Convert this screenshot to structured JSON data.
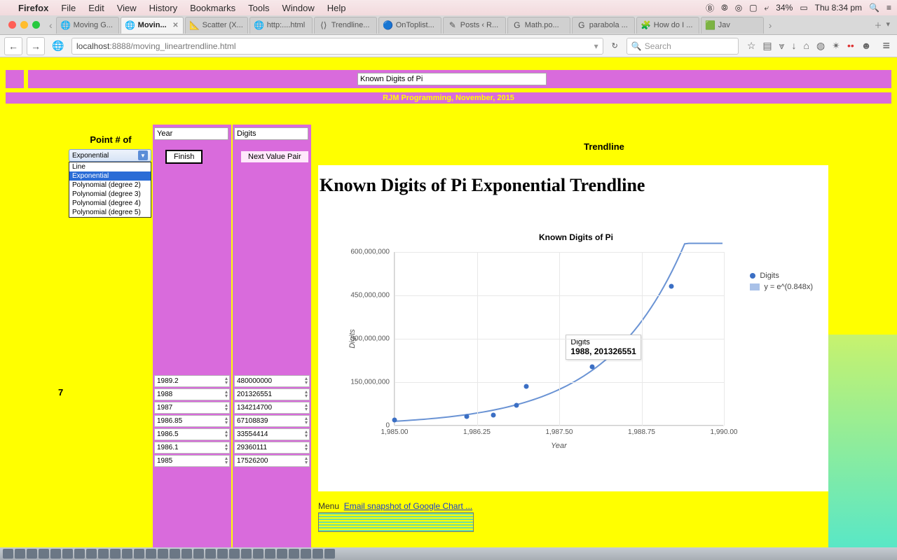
{
  "menubar": {
    "app": "Firefox",
    "items": [
      "File",
      "Edit",
      "View",
      "History",
      "Bookmarks",
      "Tools",
      "Window",
      "Help"
    ],
    "battery": "34%",
    "clock": "Thu 8:34 pm"
  },
  "tabs": [
    {
      "fav": "🌐",
      "label": "Moving G..."
    },
    {
      "fav": "🌐",
      "label": "Movin...",
      "active": true,
      "close": true
    },
    {
      "fav": "📐",
      "label": "Scatter (X..."
    },
    {
      "fav": "🌐",
      "label": "http:....html"
    },
    {
      "fav": "⟨⟩",
      "label": "Trendline..."
    },
    {
      "fav": "🔵",
      "label": "OnToplist..."
    },
    {
      "fav": "✎",
      "label": "Posts ‹ R..."
    },
    {
      "fav": "G",
      "label": "Math.po..."
    },
    {
      "fav": "G",
      "label": "parabola ..."
    },
    {
      "fav": "🧩",
      "label": "How do I ..."
    },
    {
      "fav": "🟩",
      "label": "Jav"
    }
  ],
  "url": {
    "host": "localhost",
    "port": ":8888",
    "path": "/moving_lineartrendline.html"
  },
  "search_placeholder": "Search",
  "titleInput": "Known Digits of Pi",
  "credit": "RJM Programming, November, 2015",
  "pointLabel": "Point # of",
  "trendLabel": "Trendline",
  "xHeader": "Year",
  "yHeader": "Digits",
  "finish": "Finish",
  "next": "Next Value Pair",
  "rowIndex": "7",
  "select": {
    "current": "Exponential",
    "options": [
      "Line",
      "Exponential",
      "Polynomial (degree 2)",
      "Polynomial (degree 3)",
      "Polynomial (degree 4)",
      "Polynomial (degree 5)"
    ]
  },
  "rows": [
    {
      "x": "1989.2",
      "y": "480000000"
    },
    {
      "x": "1988",
      "y": "201326551"
    },
    {
      "x": "1987",
      "y": "134214700"
    },
    {
      "x": "1986.85",
      "y": "67108839"
    },
    {
      "x": "1986.5",
      "y": "33554414"
    },
    {
      "x": "1986.1",
      "y": "29360111"
    },
    {
      "x": "1985",
      "y": "17526200"
    }
  ],
  "chartHeading": "Known Digits of Pi Exponential Trendline",
  "tooltip": {
    "series": "Digits",
    "label": "1988, 201326551"
  },
  "legend": {
    "points": "Digits",
    "curve": "y =  e^(0.848x)"
  },
  "menuLink": "Menu",
  "emailLink": "Email snapshot of Google Chart ...",
  "chart_data": {
    "type": "scatter",
    "title": "Known Digits of Pi",
    "xlabel": "Year",
    "ylabel": "Digits",
    "xlim": [
      1985,
      1990
    ],
    "ylim": [
      0,
      600000000
    ],
    "xticks": [
      1985.0,
      1986.25,
      1987.5,
      1988.75,
      1990.0
    ],
    "yticks": [
      0,
      150000000,
      300000000,
      450000000,
      600000000
    ],
    "yticklabels": [
      "0",
      "150,000,000",
      "300,000,000",
      "450,000,000",
      "600,000,000"
    ],
    "series": [
      {
        "name": "Digits",
        "x": [
          1985,
          1986.1,
          1986.5,
          1986.85,
          1987,
          1988,
          1989.2
        ],
        "y": [
          17526200,
          29360111,
          33554414,
          67108839,
          134214700,
          201326551,
          480000000
        ]
      }
    ],
    "trendline": {
      "name": "y = e^(0.848x)",
      "type": "exponential",
      "coef": 0.848
    }
  }
}
